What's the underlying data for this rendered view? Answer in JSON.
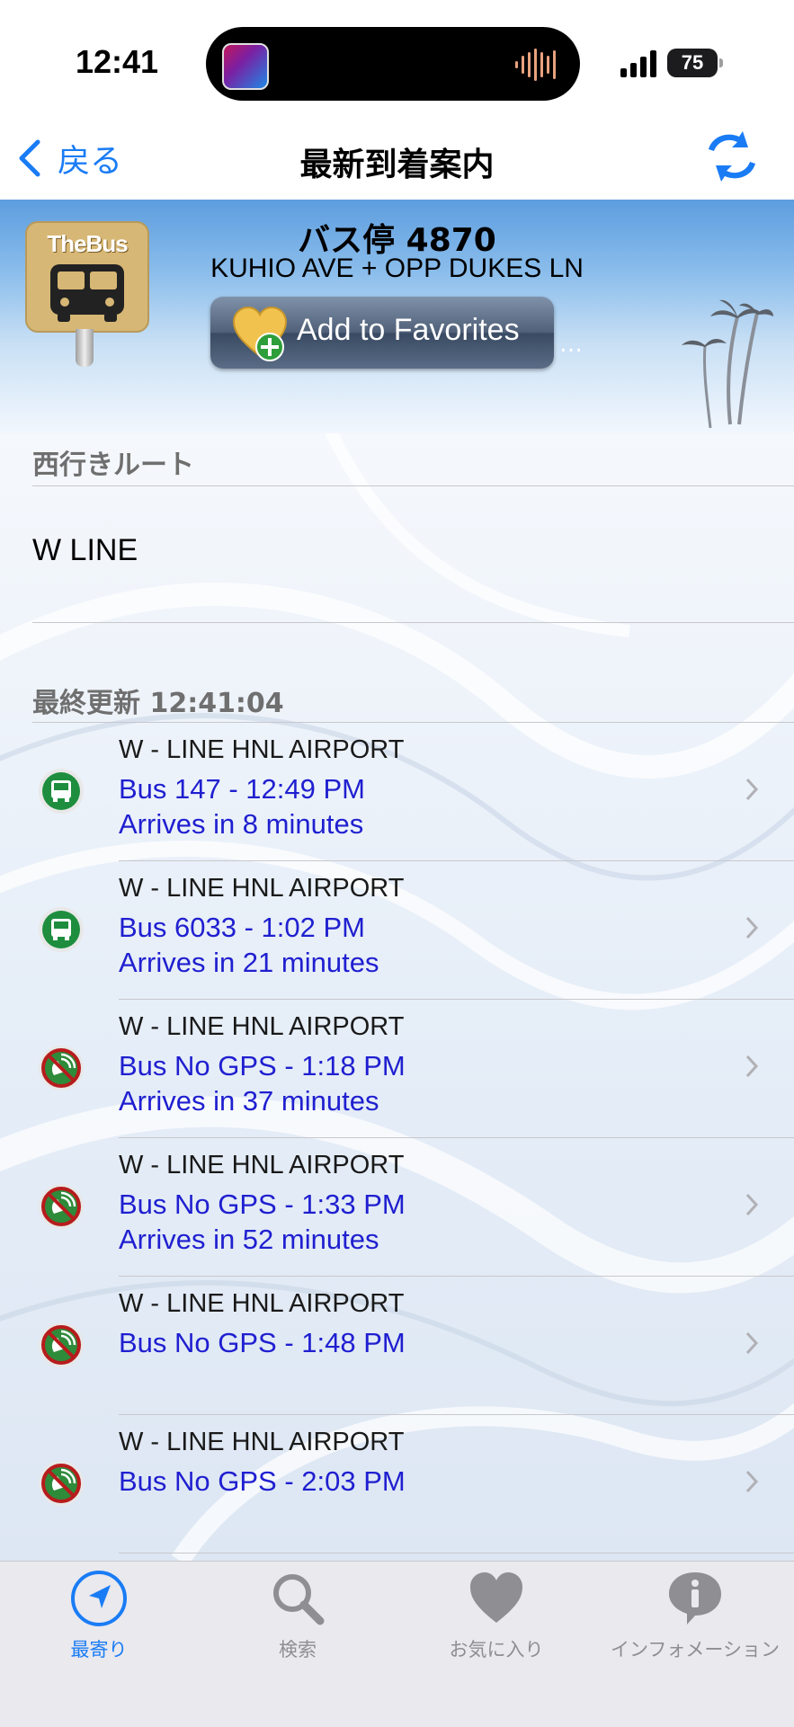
{
  "status_bar": {
    "time": "12:41",
    "battery": "75"
  },
  "nav": {
    "back_label": "戻る",
    "title": "最新到着案内"
  },
  "header": {
    "logo_text": "TheBus",
    "stop_number": "バス停 4870",
    "stop_name": "KUHIO AVE + OPP DUKES LN",
    "favorites_label": "Add to Favorites"
  },
  "route_section": {
    "header": "西行きルート",
    "route": "W LINE"
  },
  "update_section": {
    "header": "最終更新 12:41:04"
  },
  "arrivals": [
    {
      "destination": "W - LINE HNL AIRPORT",
      "time": "Bus 147 -  12:49 PM",
      "eta": "Arrives in 8 minutes",
      "icon": "bus-gps-icon"
    },
    {
      "destination": "W - LINE HNL AIRPORT",
      "time": "Bus 6033 -  1:02 PM",
      "eta": "Arrives in 21 minutes",
      "icon": "bus-gps-icon"
    },
    {
      "destination": "W - LINE HNL AIRPORT",
      "time": "Bus No GPS -  1:18 PM",
      "eta": "Arrives in 37 minutes",
      "icon": "no-gps-icon"
    },
    {
      "destination": "W - LINE HNL AIRPORT",
      "time": "Bus No GPS -  1:33 PM",
      "eta": "Arrives in 52 minutes",
      "icon": "no-gps-icon"
    },
    {
      "destination": "W - LINE HNL AIRPORT",
      "time": "Bus No GPS -  1:48 PM",
      "eta": "",
      "icon": "no-gps-icon"
    },
    {
      "destination": "W - LINE HNL AIRPORT",
      "time": "Bus No GPS -  2:03 PM",
      "eta": "",
      "icon": "no-gps-icon"
    }
  ],
  "tabs": [
    {
      "label": "最寄り",
      "icon": "location-arrow-icon",
      "active": true
    },
    {
      "label": "検索",
      "icon": "search-icon",
      "active": false
    },
    {
      "label": "お気に入り",
      "icon": "heart-icon",
      "active": false
    },
    {
      "label": "インフォメーション",
      "icon": "info-icon",
      "active": false
    }
  ],
  "colors": {
    "accent": "#1a7cf5",
    "arrival_text": "#1f1fd0",
    "gps_green": "#1e8e3e",
    "no_gps_red": "#b71c1c"
  }
}
